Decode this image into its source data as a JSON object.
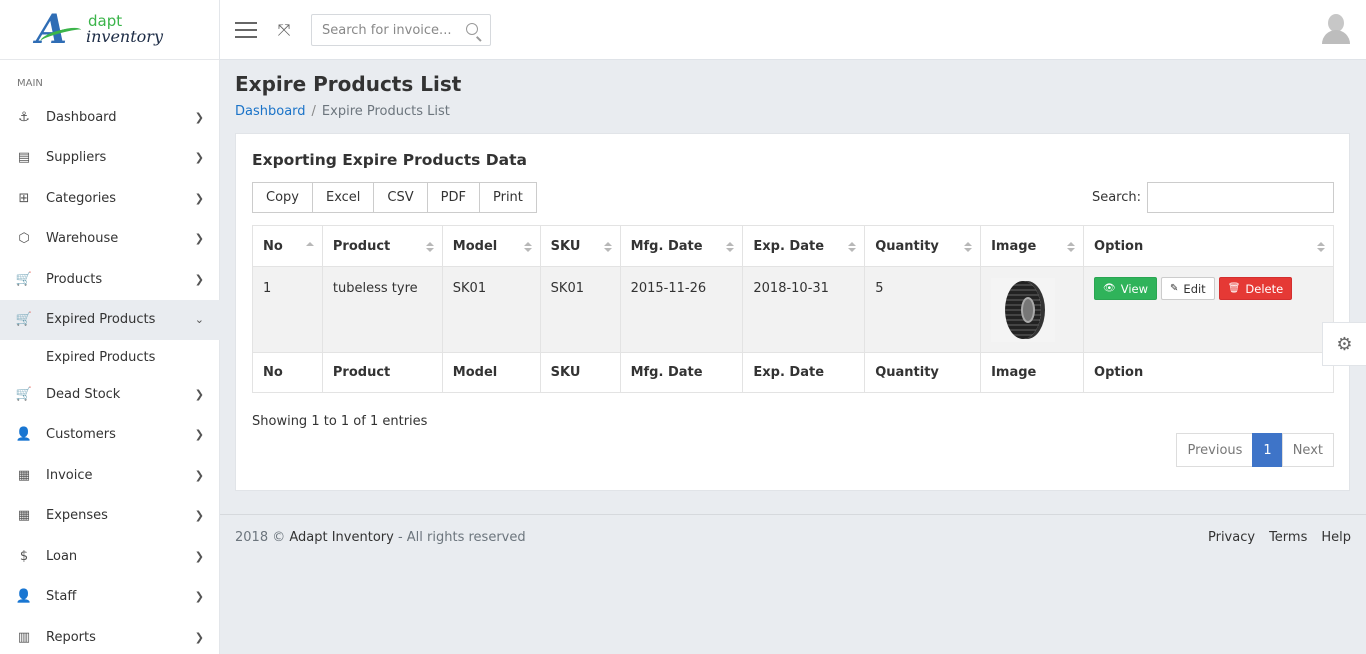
{
  "brand": {
    "logo_letter": "A",
    "line1": "dapt",
    "line2": "inventory"
  },
  "sidebar": {
    "section": "MAIN",
    "items": [
      {
        "label": "Dashboard",
        "icon": "anchor-icon",
        "glyph": "⚓"
      },
      {
        "label": "Suppliers",
        "icon": "id-card-icon",
        "glyph": "▤"
      },
      {
        "label": "Categories",
        "icon": "grid-icon",
        "glyph": "⊞"
      },
      {
        "label": "Warehouse",
        "icon": "box-icon",
        "glyph": "⬡"
      },
      {
        "label": "Products",
        "icon": "cart-icon",
        "glyph": "🛒"
      },
      {
        "label": "Expired Products",
        "icon": "cart-icon",
        "glyph": "🛒"
      },
      {
        "label": "Dead Stock",
        "icon": "cart-icon",
        "glyph": "🛒"
      },
      {
        "label": "Customers",
        "icon": "user-icon",
        "glyph": "👤"
      },
      {
        "label": "Invoice",
        "icon": "receipt-icon",
        "glyph": "▦"
      },
      {
        "label": "Expenses",
        "icon": "receipt-icon",
        "glyph": "▦"
      },
      {
        "label": "Loan",
        "icon": "dollar-icon",
        "glyph": "$"
      },
      {
        "label": "Staff",
        "icon": "user-icon",
        "glyph": "👤"
      },
      {
        "label": "Reports",
        "icon": "bar-chart-icon",
        "glyph": "▥"
      }
    ],
    "sub_item": "Expired Products"
  },
  "topbar": {
    "search_placeholder": "Search for invoice..."
  },
  "page": {
    "title": "Expire Products List",
    "breadcrumb_home": "Dashboard",
    "breadcrumb_sep": "/",
    "breadcrumb_current": "Expire Products List"
  },
  "card": {
    "title": "Exporting Expire Products Data",
    "export_buttons": [
      "Copy",
      "Excel",
      "CSV",
      "PDF",
      "Print"
    ],
    "search_label": "Search:"
  },
  "table": {
    "columns": [
      "No",
      "Product",
      "Model",
      "SKU",
      "Mfg. Date",
      "Exp. Date",
      "Quantity",
      "Image",
      "Option"
    ],
    "rows": [
      {
        "no": "1",
        "product": "tubeless tyre",
        "model": "SK01",
        "sku": "SK01",
        "mfg": "2015-11-26",
        "exp": "2018-10-31",
        "qty": "5"
      }
    ],
    "actions": {
      "view": "View",
      "edit": "Edit",
      "delete": "Delete"
    }
  },
  "info": "Showing 1 to 1 of 1 entries",
  "pagination": {
    "previous": "Previous",
    "current": "1",
    "next": "Next"
  },
  "footer": {
    "copy_prefix": "2018 ©",
    "brand": "Adapt Inventory",
    "copy_suffix": "- All rights reserved",
    "links": [
      "Privacy",
      "Terms",
      "Help"
    ]
  },
  "colors": {
    "primary": "#3e74c8",
    "success": "#2fb35a",
    "danger": "#e53935",
    "link": "#1a73c8"
  }
}
